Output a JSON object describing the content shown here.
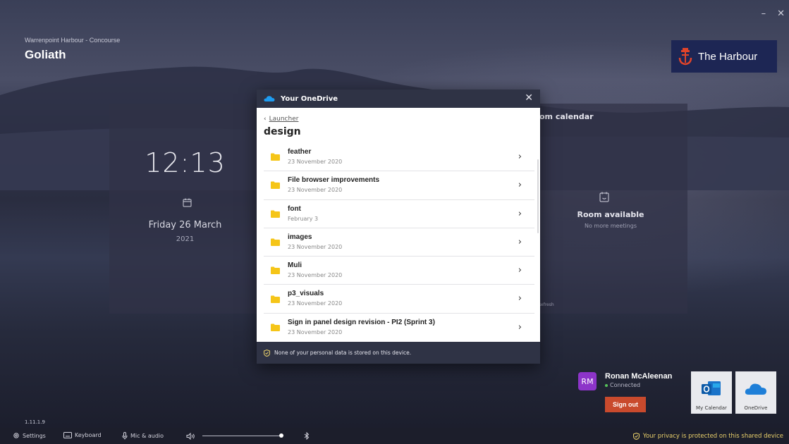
{
  "window": {
    "minimize_glyph": "–",
    "close_glyph": "✕"
  },
  "venue": {
    "location": "Warrenpoint Harbour - Concourse",
    "room_name": "Goliath"
  },
  "brand": {
    "name": "The Harbour",
    "color": "#1d2654",
    "icon": "anchor-icon"
  },
  "clock": {
    "time": "12:13",
    "date": "Friday 26 March",
    "year": "2021",
    "icon": "calendar-icon"
  },
  "room": {
    "title": "om calendar",
    "status": "Room available",
    "substatus": "No more meetings",
    "refresh": "Refresh",
    "icon": "calendar-check-icon"
  },
  "onedrive": {
    "title": "Your OneDrive",
    "close": "✕",
    "breadcrumb": "Launcher",
    "folder": "design",
    "items": [
      {
        "name": "feather",
        "date": "23 November 2020"
      },
      {
        "name": "File browser improvements",
        "date": "23 November 2020"
      },
      {
        "name": "font",
        "date": "February 3"
      },
      {
        "name": "images",
        "date": "23 November 2020"
      },
      {
        "name": "Muli",
        "date": "23 November 2020"
      },
      {
        "name": "p3_visuals",
        "date": "23 November 2020"
      },
      {
        "name": "Sign in panel design revision - PI2 (Sprint 3)",
        "date": "23 November 2020"
      }
    ],
    "footer": "None of your personal data is stored on this device.",
    "accent_folder": "#f5c518"
  },
  "user": {
    "initials": "RM",
    "name": "Ronan McAleenan",
    "status": "Connected",
    "signout": "Sign out",
    "signout_color": "#c94a2d",
    "avatar_color": "#8d34c9"
  },
  "apps": [
    {
      "label": "My Calendar",
      "icon": "outlook-icon"
    },
    {
      "label": "OneDrive",
      "icon": "onedrive-icon"
    }
  ],
  "version": "1.11.1.9",
  "bottombar": {
    "settings": "Settings",
    "keyboard": "Keyboard",
    "mic": "Mic & audio",
    "volume": 0.98,
    "privacy": "Your privacy is protected on this shared device"
  }
}
